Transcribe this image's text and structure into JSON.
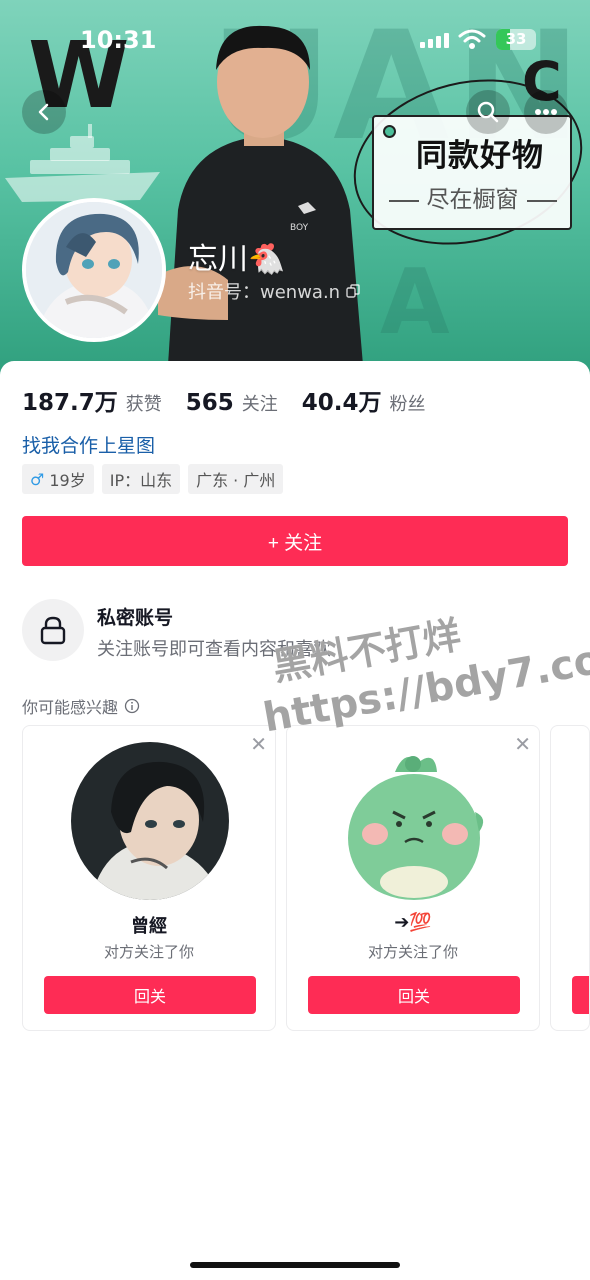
{
  "status_bar": {
    "time": "10:31",
    "battery": "33"
  },
  "banner": {
    "bg_letters": {
      "w": "W",
      "c": "C",
      "big": "UANG",
      "a": "A"
    },
    "promo_title": "同款好物",
    "promo_sub": "尽在橱窗"
  },
  "profile": {
    "name": "忘川",
    "name_emoji": "🐔",
    "douyin_id": "抖音号：wenwa.n"
  },
  "stats": [
    {
      "value": "187.7万",
      "label": "获赞"
    },
    {
      "value": "565",
      "label": "关注"
    },
    {
      "value": "40.4万",
      "label": "粉丝"
    }
  ],
  "bio": "找我合作上星图",
  "tags": {
    "gender_symbol": "♂",
    "age": "19岁",
    "ip": "IP：山东",
    "location": "广东 · 广州"
  },
  "follow_button": "+ 关注",
  "private": {
    "title": "私密账号",
    "desc": "关注账号即可查看内容和喜欢"
  },
  "suggestions": {
    "title": "你可能感兴趣",
    "cards": [
      {
        "name": "曾經",
        "desc": "对方关注了你",
        "button": "回关"
      },
      {
        "name": "➔💯",
        "desc": "对方关注了你",
        "button": "回关"
      }
    ]
  },
  "watermark": {
    "line1": "黑料不打烊",
    "line2": "https://bdy7.co"
  }
}
